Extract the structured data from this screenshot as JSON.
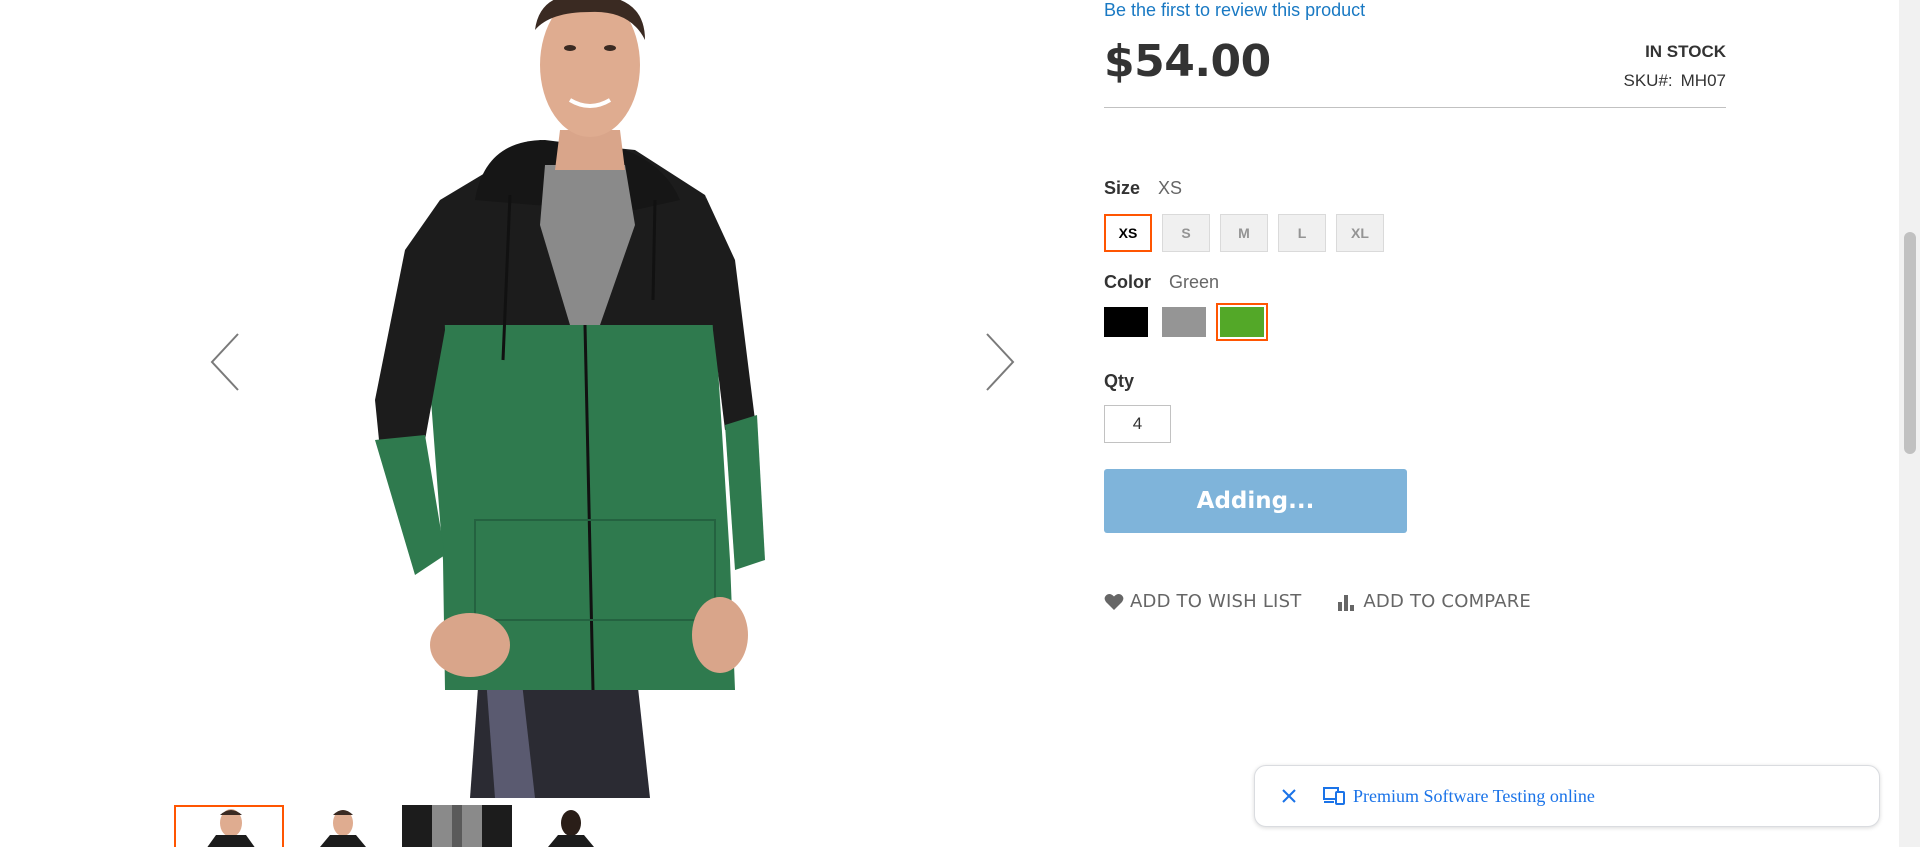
{
  "product": {
    "review_link": "Be the first to review this product",
    "price": "$54.00",
    "stock": "IN STOCK",
    "sku_label": "SKU#:",
    "sku_value": "MH07"
  },
  "options": {
    "size": {
      "label": "Size",
      "selected": "XS",
      "values": [
        "XS",
        "S",
        "M",
        "L",
        "XL"
      ]
    },
    "color": {
      "label": "Color",
      "selected": "Green",
      "swatches": [
        {
          "name": "Black",
          "hex": "#000000"
        },
        {
          "name": "Gray",
          "hex": "#959595"
        },
        {
          "name": "Green",
          "hex": "#53a828"
        }
      ]
    }
  },
  "qty": {
    "label": "Qty",
    "value": "4"
  },
  "cart": {
    "button_label": "Adding..."
  },
  "actions": {
    "wishlist": "ADD TO WISH LIST",
    "compare": "ADD TO COMPARE"
  },
  "toast": {
    "text": "Premium Software Testing online"
  },
  "colors": {
    "accent": "#ff5501",
    "link": "#1979c3",
    "button_disabled": "#7fb4da"
  }
}
